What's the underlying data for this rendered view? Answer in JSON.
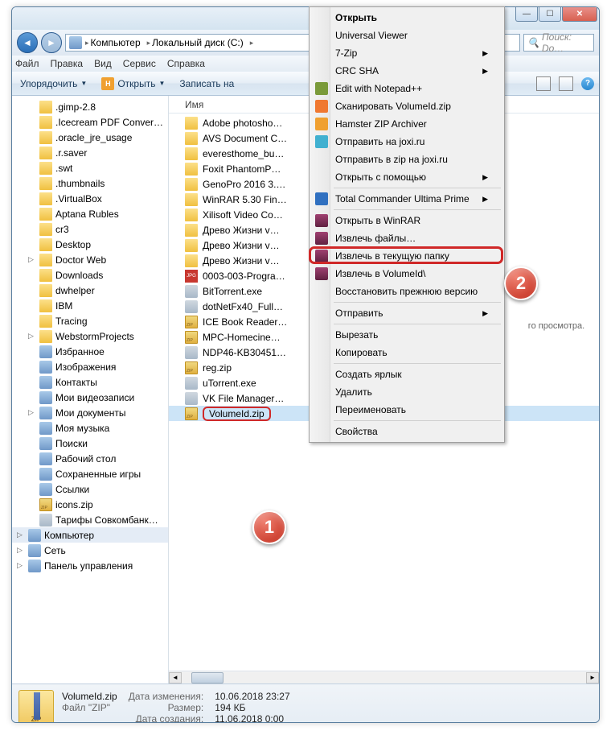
{
  "breadcrumb": {
    "root": "Компьютер",
    "drive": "Локальный диск (C:)"
  },
  "search": {
    "placeholder": "Поиск: Do…"
  },
  "menubar": [
    "Файл",
    "Правка",
    "Вид",
    "Сервис",
    "Справка"
  ],
  "toolbar": {
    "organize": "Упорядочить",
    "open": "Открыть",
    "burn": "Записать на"
  },
  "tree": [
    {
      "l": ".gimp-2.8",
      "t": "folder"
    },
    {
      "l": ".Icecream PDF Conver…",
      "t": "folder"
    },
    {
      "l": ".oracle_jre_usage",
      "t": "folder"
    },
    {
      "l": ".r.saver",
      "t": "folder"
    },
    {
      "l": ".swt",
      "t": "folder"
    },
    {
      "l": ".thumbnails",
      "t": "folder"
    },
    {
      "l": ".VirtualBox",
      "t": "folder"
    },
    {
      "l": "Aptana Rubles",
      "t": "folder"
    },
    {
      "l": "cr3",
      "t": "folder"
    },
    {
      "l": "Desktop",
      "t": "folder"
    },
    {
      "l": "Doctor Web",
      "t": "folder"
    },
    {
      "l": "Downloads",
      "t": "folder"
    },
    {
      "l": "dwhelper",
      "t": "folder"
    },
    {
      "l": "IBM",
      "t": "folder"
    },
    {
      "l": "Tracing",
      "t": "folder"
    },
    {
      "l": "WebstormProjects",
      "t": "folder"
    },
    {
      "l": "Избранное",
      "t": "sys"
    },
    {
      "l": "Изображения",
      "t": "sys"
    },
    {
      "l": "Контакты",
      "t": "sys"
    },
    {
      "l": "Мои видеозаписи",
      "t": "sys"
    },
    {
      "l": "Мои документы",
      "t": "sys"
    },
    {
      "l": "Моя музыка",
      "t": "sys"
    },
    {
      "l": "Поиски",
      "t": "sys"
    },
    {
      "l": "Рабочий стол",
      "t": "sys"
    },
    {
      "l": "Сохраненные игры",
      "t": "sys"
    },
    {
      "l": "Ссылки",
      "t": "sys"
    },
    {
      "l": "icons.zip",
      "t": "zip"
    },
    {
      "l": "Тарифы Совкомбанк…",
      "t": "exe"
    }
  ],
  "tree_root": {
    "computer": "Компьютер",
    "network": "Сеть",
    "cpanel": "Панель управления"
  },
  "column": {
    "name": "Имя"
  },
  "files": [
    {
      "l": "Adobe photosho…",
      "t": "folder"
    },
    {
      "l": "AVS Document C…",
      "t": "folder"
    },
    {
      "l": "everesthome_bu…",
      "t": "folder"
    },
    {
      "l": "Foxit PhantomP…",
      "t": "folder"
    },
    {
      "l": "GenoPro 2016 3.…",
      "t": "folder"
    },
    {
      "l": "WinRAR 5.30 Fin…",
      "t": "folder"
    },
    {
      "l": "Xilisoft Video Co…",
      "t": "folder"
    },
    {
      "l": "Древо Жизни v…",
      "t": "folder"
    },
    {
      "l": "Древо Жизни v…",
      "t": "folder"
    },
    {
      "l": "Древо Жизни v…",
      "t": "folder"
    },
    {
      "l": "0003-003-Progra…",
      "t": "jpg"
    },
    {
      "l": "BitTorrent.exe",
      "t": "exe"
    },
    {
      "l": "dotNetFx40_Full…",
      "t": "exe"
    },
    {
      "l": "ICE Book Reader…",
      "t": "zip"
    },
    {
      "l": "MPC-Homecine…",
      "t": "zip"
    },
    {
      "l": "NDP46-KB30451…",
      "t": "exe"
    },
    {
      "l": "reg.zip",
      "t": "zip"
    },
    {
      "l": "uTorrent.exe",
      "t": "exe"
    },
    {
      "l": "VK File Manager…",
      "t": "exe"
    },
    {
      "l": "VolumeId.zip",
      "t": "zip",
      "sel": true
    }
  ],
  "ctx": [
    {
      "l": "Открыть",
      "bold": true
    },
    {
      "l": "Universal Viewer"
    },
    {
      "l": "7-Zip",
      "sub": true
    },
    {
      "l": "CRC SHA",
      "sub": true
    },
    {
      "l": "Edit with Notepad++",
      "ico": "npp"
    },
    {
      "l": "Сканировать VolumeId.zip",
      "ico": "avast"
    },
    {
      "l": "Hamster ZIP Archiver",
      "ico": "ham"
    },
    {
      "l": "Отправить на joxi.ru",
      "ico": "joxi"
    },
    {
      "l": "Отправить в zip на joxi.ru"
    },
    {
      "l": "Открыть с помощью",
      "sub": true
    },
    {
      "sep": true
    },
    {
      "l": "Total Commander Ultima Prime",
      "sub": true,
      "ico": "tc"
    },
    {
      "sep": true
    },
    {
      "l": "Открыть в WinRAR",
      "ico": "rar"
    },
    {
      "l": "Извлечь файлы…",
      "ico": "rar"
    },
    {
      "l": "Извлечь в текущую папку",
      "ico": "rar",
      "hl": true
    },
    {
      "l": "Извлечь в VolumeId\\",
      "ico": "rar"
    },
    {
      "l": "Восстановить прежнюю версию"
    },
    {
      "sep": true
    },
    {
      "l": "Отправить",
      "sub": true
    },
    {
      "sep": true
    },
    {
      "l": "Вырезать"
    },
    {
      "l": "Копировать"
    },
    {
      "sep": true
    },
    {
      "l": "Создать ярлык"
    },
    {
      "l": "Удалить"
    },
    {
      "l": "Переименовать"
    },
    {
      "sep": true
    },
    {
      "l": "Свойства"
    }
  ],
  "preview_msg": "го просмотра.",
  "details": {
    "filename": "VolumeId.zip",
    "filetype": "Файл \"ZIP\"",
    "mod_lbl": "Дата изменения:",
    "mod": "10.06.2018 23:27",
    "size_lbl": "Размер:",
    "size": "194 КБ",
    "created_lbl": "Дата создания:",
    "created": "11.06.2018 0:00"
  }
}
